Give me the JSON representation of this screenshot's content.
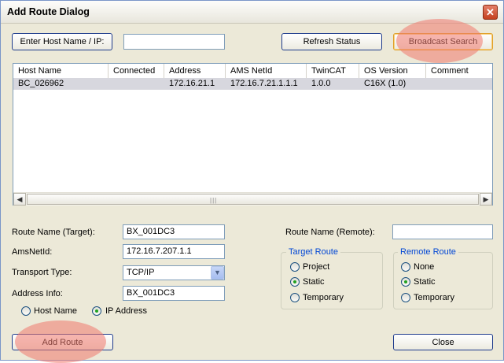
{
  "window": {
    "title": "Add Route Dialog",
    "close_glyph": "✕"
  },
  "top": {
    "enter_host_label": "Enter Host Name / IP:",
    "host_value": "",
    "refresh_label": "Refresh Status",
    "broadcast_label": "Broadcast Search"
  },
  "table": {
    "columns": [
      "Host Name",
      "Connected",
      "Address",
      "AMS NetId",
      "TwinCAT",
      "OS Version",
      "Comment"
    ],
    "rows": [
      {
        "host": "BC_026962",
        "connected": "",
        "address": "172.16.21.1",
        "ams": "172.16.7.21.1.1.1",
        "twincat": "1.0.0",
        "os": "C16X (1.0)",
        "comment": ""
      }
    ]
  },
  "route": {
    "route_name_target_label": "Route Name (Target):",
    "route_name_target_value": "BX_001DC3",
    "amsnetid_label": "AmsNetId:",
    "amsnetid_value": "172.16.7.207.1.1",
    "transport_label": "Transport Type:",
    "transport_value": "TCP/IP",
    "address_label": "Address Info:",
    "address_value": "BX_001DC3",
    "radio_hostname": "Host Name",
    "radio_ip": "IP Address",
    "selected_address_mode": "IP Address",
    "route_name_remote_label": "Route Name (Remote):",
    "route_name_remote_value": ""
  },
  "target_route": {
    "title": "Target Route",
    "options": [
      "Project",
      "Static",
      "Temporary"
    ],
    "selected": "Static"
  },
  "remote_route": {
    "title": "Remote Route",
    "options": [
      "None",
      "Static",
      "Temporary"
    ],
    "selected": "Static"
  },
  "bottom": {
    "add_route_label": "Add Route",
    "close_label": "Close"
  },
  "colors": {
    "highlight": "#f0786e",
    "selected_row": "#d7d7de",
    "group_title": "#0046d5"
  }
}
